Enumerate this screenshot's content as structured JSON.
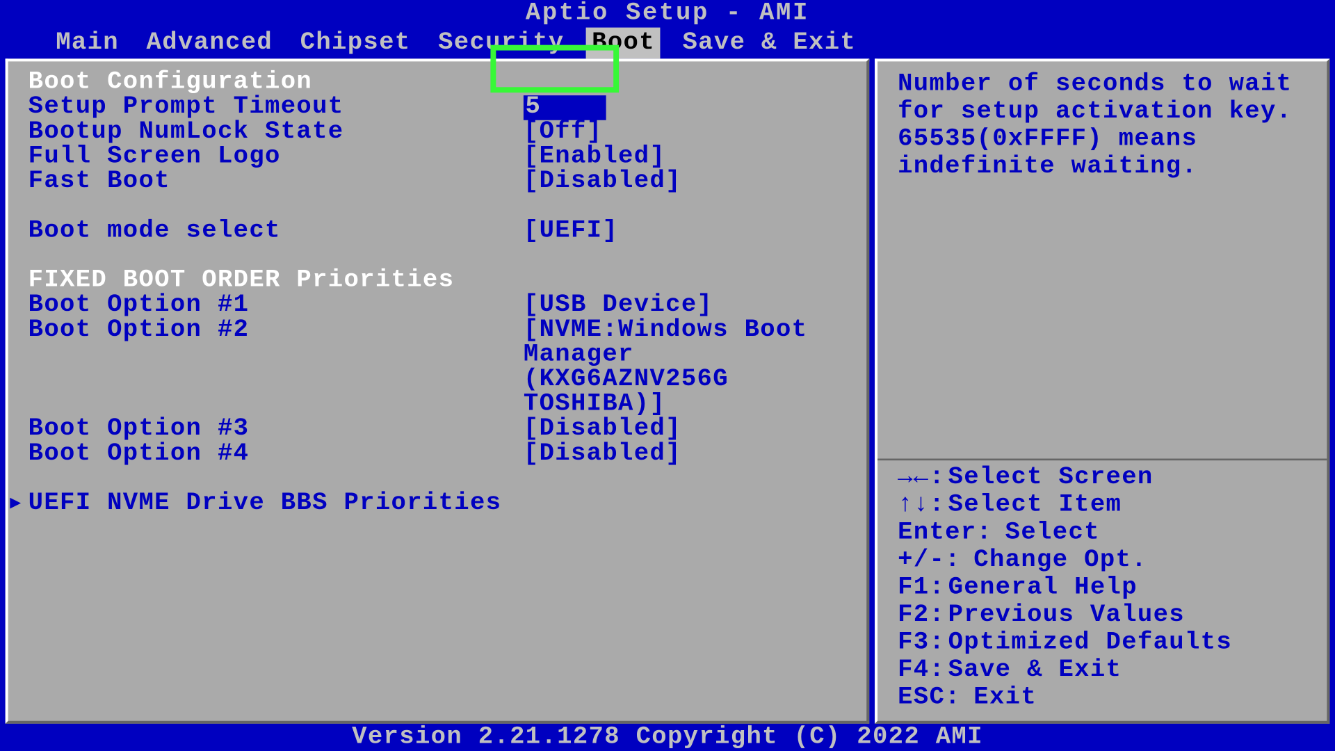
{
  "title": "Aptio Setup - AMI",
  "tabs": [
    {
      "label": "Main",
      "active": false
    },
    {
      "label": "Advanced",
      "active": false
    },
    {
      "label": "Chipset",
      "active": false
    },
    {
      "label": "Security",
      "active": false
    },
    {
      "label": "Boot",
      "active": true
    },
    {
      "label": "Save & Exit",
      "active": false
    }
  ],
  "sections": {
    "bootConfig": "Boot Configuration",
    "fixedOrder": "FIXED BOOT ORDER Priorities"
  },
  "options": {
    "promptTimeout": {
      "label": "Setup Prompt Timeout",
      "value": "5"
    },
    "numlock": {
      "label": "Bootup NumLock State",
      "value": "[Off]"
    },
    "fullScreenLogo": {
      "label": "Full Screen Logo",
      "value": "[Enabled]"
    },
    "fastBoot": {
      "label": "Fast Boot",
      "value": "[Disabled]"
    },
    "bootMode": {
      "label": "Boot mode select",
      "value": "[UEFI]"
    },
    "opt1": {
      "label": "Boot Option #1",
      "value": "[USB Device]"
    },
    "opt2": {
      "label": "Boot Option #2",
      "value": "[NVME:Windows Boot Manager (KXG6AZNV256G TOSHIBA)]"
    },
    "opt3": {
      "label": "Boot Option #3",
      "value": "[Disabled]"
    },
    "opt4": {
      "label": "Boot Option #4",
      "value": "[Disabled]"
    }
  },
  "submenu": "UEFI NVME Drive BBS Priorities",
  "help": {
    "text": "Number of seconds to wait for setup activation key. 65535(0xFFFF) means indefinite waiting.",
    "keys": [
      {
        "sym": "→←:",
        "desc": "Select Screen"
      },
      {
        "sym": "↑↓:",
        "desc": "Select Item"
      },
      {
        "sym": "Enter:",
        "desc": "Select"
      },
      {
        "sym": "+/-:",
        "desc": "Change Opt."
      },
      {
        "sym": "F1:",
        "desc": "General Help"
      },
      {
        "sym": "F2:",
        "desc": "Previous Values"
      },
      {
        "sym": "F3:",
        "desc": "Optimized Defaults"
      },
      {
        "sym": "F4:",
        "desc": "Save & Exit"
      },
      {
        "sym": "ESC:",
        "desc": "Exit"
      }
    ]
  },
  "footer": "Version 2.21.1278 Copyright (C) 2022 AMI"
}
